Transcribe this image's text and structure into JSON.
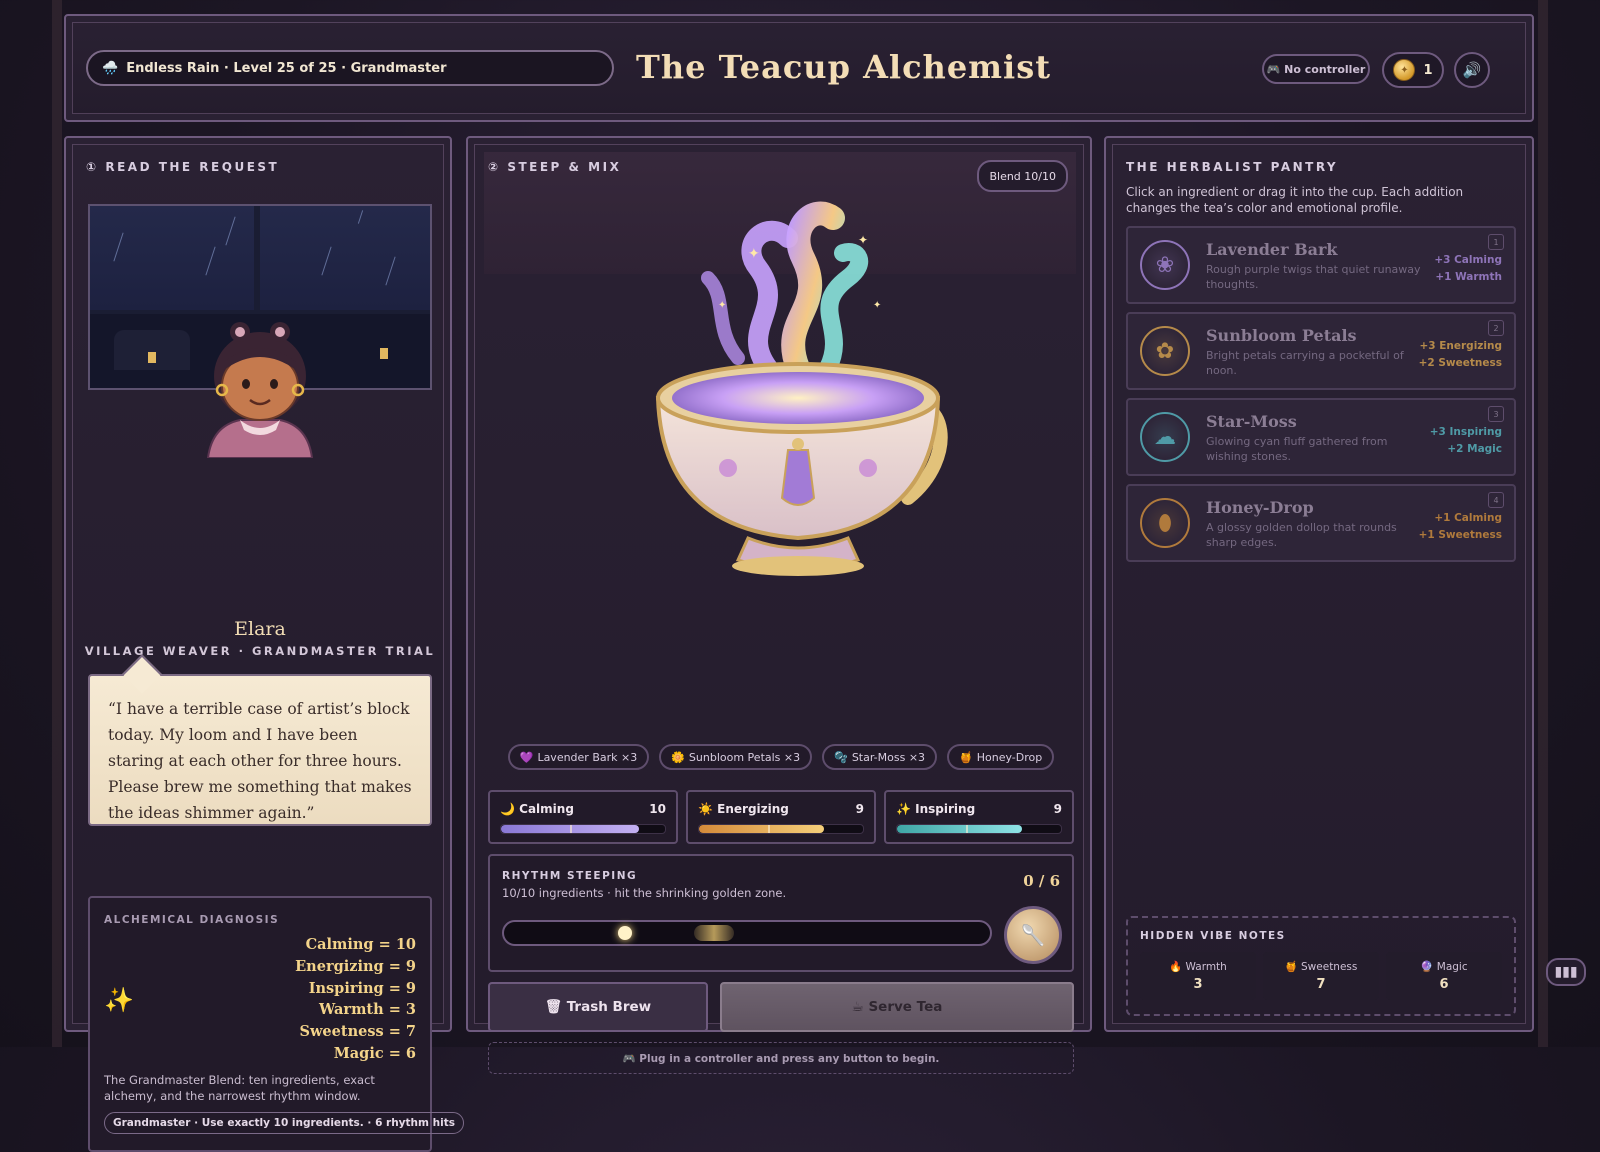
{
  "header": {
    "level_text": "Endless Rain · Level 25 of 25 · Grandmaster",
    "title": "The Teacup Alchemist",
    "controller_status": "🎮 No controller",
    "coins": "1",
    "sound_icon": "speaker-icon"
  },
  "request": {
    "section_title": "① READ THE REQUEST",
    "customer_name": "Elara",
    "customer_role": "VILLAGE WEAVER · GRANDMASTER TRIAL",
    "quote": "“I have a terrible case of artist’s block today. My loom and I have been staring at each other for three hours. Please brew me something that makes the ideas shimmer again.”",
    "diagnosis": {
      "title": "ALCHEMICAL DIAGNOSIS",
      "targets": [
        "Calming = 10",
        "Energizing = 9",
        "Inspiring = 9",
        "Warmth = 3",
        "Sweetness = 7",
        "Magic = 6"
      ],
      "description": "The Grandmaster Blend: ten ingredients, exact alchemy, and the narrowest rhythm window.",
      "rule": "Grandmaster · Use exactly 10 ingredients. · 6 rhythm hits"
    }
  },
  "steep": {
    "section_title": "② STEEP & MIX",
    "blend_badge": "Blend 10/10",
    "ingredients_added": [
      {
        "icon": "💜",
        "label": "Lavender Bark ×3"
      },
      {
        "icon": "🌼",
        "label": "Sunbloom Petals ×3"
      },
      {
        "icon": "🫧",
        "label": "Star-Moss ×3"
      },
      {
        "icon": "🍯",
        "label": "Honey-Drop"
      }
    ],
    "stats": [
      {
        "icon": "🌙",
        "label": "Calming",
        "value": "10",
        "fill": 0.84,
        "target": 0.42,
        "color": "linear-gradient(90deg,#8a78d6,#c3b0f2)"
      },
      {
        "icon": "☀️",
        "label": "Energizing",
        "value": "9",
        "fill": 0.76,
        "target": 0.42,
        "color": "linear-gradient(90deg,#d48a3a,#f5cf7a)"
      },
      {
        "icon": "✨",
        "label": "Inspiring",
        "value": "9",
        "fill": 0.76,
        "target": 0.42,
        "color": "linear-gradient(90deg,#3fa6a6,#8fe3e6)"
      }
    ],
    "rhythm": {
      "title": "RHYTHM STEEPING",
      "subtitle": "10/10 ingredients · hit the shrinking golden zone.",
      "count": "0 / 6"
    },
    "trash_label": "🗑 Trash Brew",
    "serve_label": "☕ Serve Tea",
    "hint": "🎮 Plug in a controller and press any button to begin."
  },
  "pantry": {
    "title": "THE HERBALIST PANTRY",
    "description": "Click an ingredient or drag it into the cup. Each addition changes the tea’s color and emotional profile.",
    "items": [
      {
        "key": "1",
        "icon": "lavender-icon",
        "glyph": "❀",
        "name": "Lavender Bark",
        "desc": "Rough purple twigs that quiet runaway thoughts.",
        "fx1": "+3 Calming",
        "fx2": "+1 Warmth",
        "color": "#8e74b8"
      },
      {
        "key": "2",
        "icon": "sunflower-icon",
        "glyph": "✿",
        "name": "Sunbloom Petals",
        "desc": "Bright petals carrying a pocketful of noon.",
        "fx1": "+3 Energizing",
        "fx2": "+2 Sweetness",
        "color": "#b58a4a"
      },
      {
        "key": "3",
        "icon": "moss-icon",
        "glyph": "☁",
        "name": "Star-Moss",
        "desc": "Glowing cyan fluff gathered from wishing stones.",
        "fx1": "+3 Inspiring",
        "fx2": "+2 Magic",
        "color": "#4f9aa6"
      },
      {
        "key": "4",
        "icon": "honey-jar-icon",
        "glyph": "⬮",
        "name": "Honey-Drop",
        "desc": "A glossy golden dollop that rounds sharp edges.",
        "fx1": "+1 Calming",
        "fx2": "+1 Sweetness",
        "color": "#b07a3c"
      }
    ],
    "vibe_notes": {
      "title": "HIDDEN VIBE NOTES",
      "items": [
        {
          "label": "🔥 Warmth",
          "value": "3"
        },
        {
          "label": "🍯 Sweetness",
          "value": "7"
        },
        {
          "label": "🔮 Magic",
          "value": "6"
        }
      ]
    }
  }
}
